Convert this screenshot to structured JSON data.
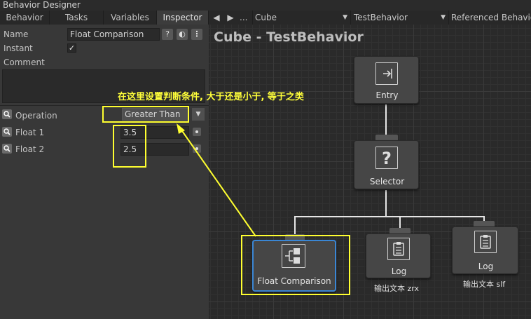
{
  "window": {
    "title": "Behavior Designer"
  },
  "tabs": [
    "Behavior",
    "Tasks",
    "Variables",
    "Inspector"
  ],
  "toolbar": {
    "prev_icon": "◀",
    "next_icon": "▶",
    "more_label": "...",
    "object_select": "Cube",
    "behavior_select": "TestBehavior",
    "referenced_label": "Referenced Behavio"
  },
  "inspector": {
    "name_label": "Name",
    "name_value": "Float Comparison",
    "instant_label": "Instant",
    "instant_checked": true,
    "comment_label": "Comment",
    "operation_label": "Operation",
    "operation_value": "Greater Than",
    "float1_label": "Float 1",
    "float1_value": "3.5",
    "float2_label": "Float 2",
    "float2_value": "2.5"
  },
  "canvas": {
    "graph_title": "Cube - TestBehavior",
    "nodes": {
      "entry": {
        "label": "Entry"
      },
      "selector": {
        "label": "Selector"
      },
      "float_comparison": {
        "label": "Float Comparison"
      },
      "log1": {
        "label": "Log",
        "comment": "输出文本 zrx"
      },
      "log2": {
        "label": "Log",
        "comment": "输出文本 slf"
      }
    }
  },
  "annotation": {
    "text": "在这里设置判断条件, 大于还是小于, 等于之类",
    "color": "#ffff30"
  }
}
